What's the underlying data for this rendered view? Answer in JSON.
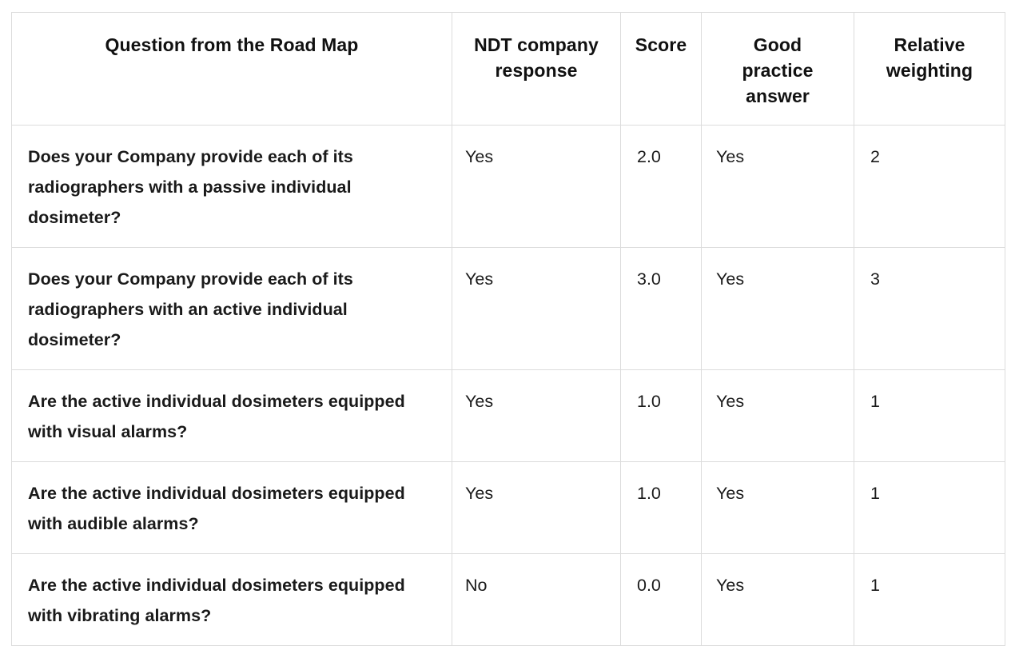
{
  "table": {
    "columns": [
      {
        "key": "question",
        "label": "Question from the Road Map"
      },
      {
        "key": "response",
        "label": "NDT company response"
      },
      {
        "key": "score",
        "label": "Score"
      },
      {
        "key": "good",
        "label": "Good practice answer"
      },
      {
        "key": "weight",
        "label": "Relative weighting"
      }
    ],
    "header": {
      "question": "Question from the Road Map",
      "response_line1": "NDT company",
      "response_line2": "response",
      "score": "Score",
      "good_line1": "Good",
      "good_line2": "practice",
      "good_line3": "answer",
      "weight_line1": "Relative",
      "weight_line2": "weighting"
    },
    "rows": [
      {
        "question": "Does your Company provide each of its radiographers with a passive individual dosimeter?",
        "response": "Yes",
        "score": "2.0",
        "good": "Yes",
        "weight": "2"
      },
      {
        "question": "Does your Company provide each of its radiographers with an active individual dosimeter?",
        "response": "Yes",
        "score": "3.0",
        "good": "Yes",
        "weight": "3"
      },
      {
        "question": "Are the active individual dosimeters equipped with visual alarms?",
        "response": "Yes",
        "score": "1.0",
        "good": "Yes",
        "weight": "1"
      },
      {
        "question": "Are the active individual dosimeters equipped with audible alarms?",
        "response": "Yes",
        "score": "1.0",
        "good": "Yes",
        "weight": "1"
      },
      {
        "question": "Are the active individual dosimeters equipped with vibrating alarms?",
        "response": "No",
        "score": "0.0",
        "good": "Yes",
        "weight": "1"
      }
    ],
    "colors": {
      "border": "#dcdcdc",
      "cell_background": "#ffffff",
      "text": "#1a1a1a"
    }
  }
}
